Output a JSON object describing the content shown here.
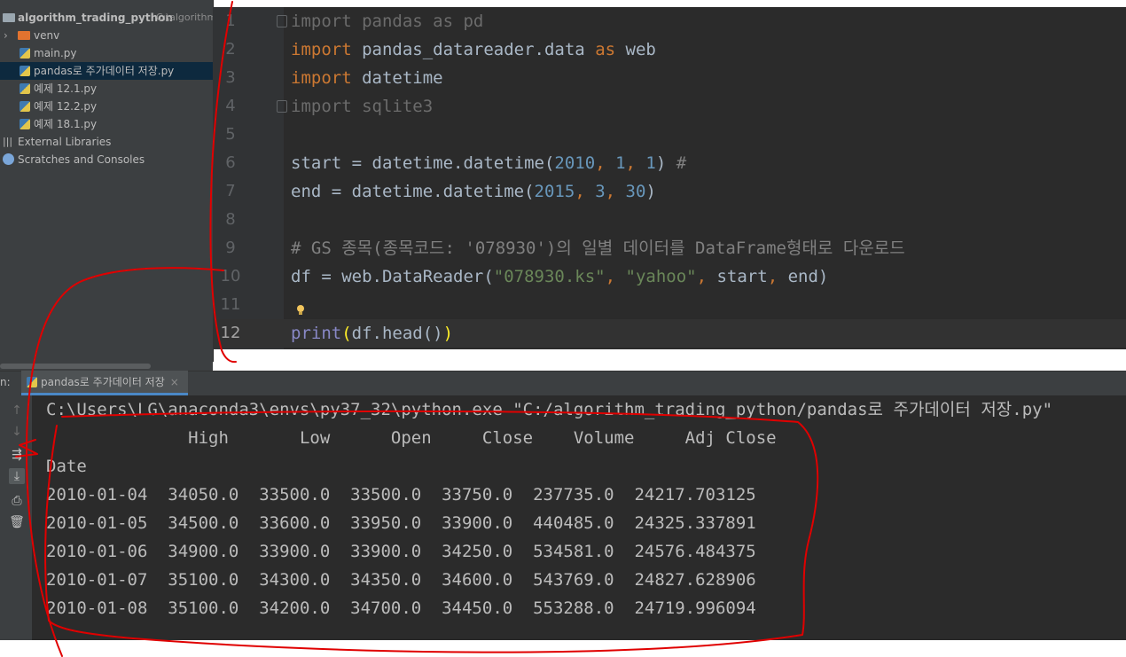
{
  "project": {
    "root": {
      "name": "algorithm_trading_python",
      "path": "C:\\algorithm"
    },
    "items": [
      {
        "label": "venv"
      },
      {
        "label": "main.py"
      },
      {
        "label": "pandas로 주가데이터 저장.py"
      },
      {
        "label": "예제 12.1.py"
      },
      {
        "label": "예제 12.2.py"
      },
      {
        "label": "예제 18.1.py"
      },
      {
        "label": "External Libraries"
      },
      {
        "label": "Scratches and Consoles"
      }
    ]
  },
  "editor": {
    "line_numbers": [
      "1",
      "2",
      "3",
      "4",
      "5",
      "6",
      "7",
      "8",
      "9",
      "10",
      "11",
      "12"
    ],
    "current_line": "12",
    "lines": {
      "l1": {
        "kw": "import",
        "rest": " pandas as pd"
      },
      "l2": {
        "kw": "import",
        "mod": " pandas_datareader.data ",
        "as": "as",
        "alias": " web"
      },
      "l3": {
        "kw": "import",
        "mod": " datetime"
      },
      "l4": {
        "kw": "import",
        "rest": " sqlite3"
      },
      "l6": {
        "pre": "start = datetime.datetime(",
        "n1": "2010",
        "c1": ", ",
        "n2": "1",
        "c2": ", ",
        "n3": "1",
        "post": ") ",
        "cm": "#"
      },
      "l7": {
        "pre": "end = datetime.datetime(",
        "n1": "2015",
        "c1": ", ",
        "n2": "3",
        "c2": ", ",
        "n3": "30",
        "post": ")"
      },
      "l9": {
        "cm": "# GS 종목(종목코드: '078930')의 일별 데이터를 DataFrame형태로 다운로드"
      },
      "l10": {
        "pre": "df = web.DataReader(",
        "s1": "\"078930.ks\"",
        "c1": ", ",
        "s2": "\"yahoo\"",
        "c2": ", ",
        "a1": "start",
        "c3": ", ",
        "a2": "end",
        "post": ")"
      },
      "l12": {
        "fn": "print",
        "open": "(",
        "body": "df.head()",
        "close": ")"
      }
    }
  },
  "run": {
    "prefix": "n:",
    "tab_label": "pandas로 주가데이터 저장",
    "tab_close": "×",
    "command": "C:\\Users\\LG\\anaconda3\\envs\\py37_32\\python.exe \"C:/algorithm_trading_python/pandas로 주가데이터 저장.py\"",
    "columns_line": "              High       Low      Open     Close    Volume     Adj Close",
    "index_name": "Date",
    "rows": [
      "2010-01-04  34050.0  33500.0  33500.0  33750.0  237735.0  24217.703125",
      "2010-01-05  34500.0  33600.0  33950.0  33900.0  440485.0  24325.337891",
      "2010-01-06  34900.0  33900.0  33900.0  34250.0  534581.0  24576.484375",
      "2010-01-07  35100.0  34300.0  34350.0  34600.0  543769.0  24827.628906",
      "2010-01-08  35100.0  34200.0  34700.0  34450.0  553288.0  24719.996094"
    ]
  },
  "colors": {
    "keyword": "#cc7832",
    "number": "#6897bb",
    "string": "#6a8759",
    "comment": "#808080",
    "annotation": "#e00000"
  }
}
